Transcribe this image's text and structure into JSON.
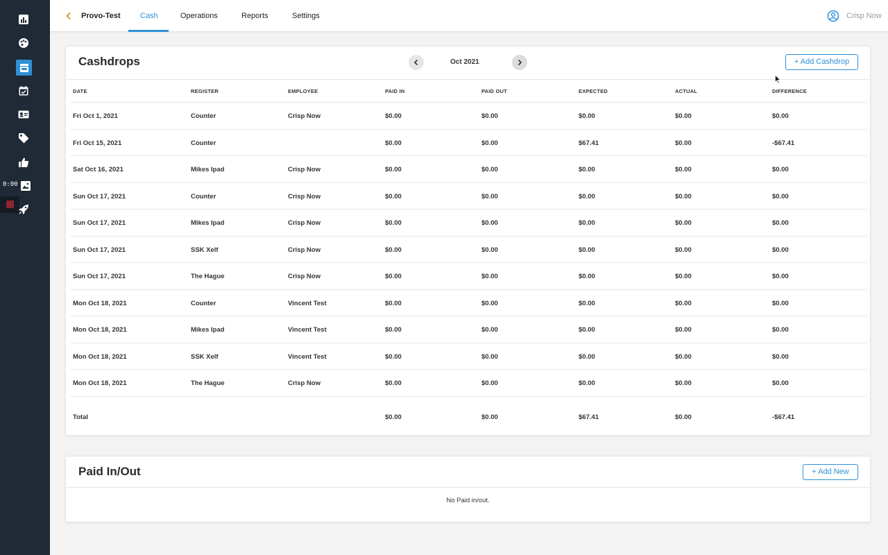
{
  "sidebar": {
    "icons": [
      "bar-chart-icon",
      "palette-icon",
      "store-icon",
      "calendar-check-icon",
      "contact-card-icon",
      "tag-icon",
      "thumbs-up-icon",
      "image-icon",
      "rocket-icon"
    ],
    "recording_time": "0:00"
  },
  "topbar": {
    "location": "Provo-Test",
    "tabs": [
      {
        "label": "Cash",
        "active": true
      },
      {
        "label": "Operations",
        "active": false
      },
      {
        "label": "Reports",
        "active": false
      },
      {
        "label": "Settings",
        "active": false
      }
    ],
    "user_name": "Crisp Now"
  },
  "cashdrops": {
    "title": "Cashdrops",
    "month": "Oct 2021",
    "add_button": "+ Add Cashdrop",
    "columns": [
      "DATE",
      "REGISTER",
      "EMPLOYEE",
      "PAID IN",
      "PAID OUT",
      "EXPECTED",
      "ACTUAL",
      "DIFFERENCE"
    ],
    "rows": [
      [
        "Fri Oct 1, 2021",
        "Counter",
        "Crisp Now",
        "$0.00",
        "$0.00",
        "$0.00",
        "$0.00",
        "$0.00"
      ],
      [
        "Fri Oct 15, 2021",
        "Counter",
        "",
        "$0.00",
        "$0.00",
        "$67.41",
        "$0.00",
        "-$67.41"
      ],
      [
        "Sat Oct 16, 2021",
        "Mikes Ipad",
        "Crisp Now",
        "$0.00",
        "$0.00",
        "$0.00",
        "$0.00",
        "$0.00"
      ],
      [
        "Sun Oct 17, 2021",
        "Counter",
        "Crisp Now",
        "$0.00",
        "$0.00",
        "$0.00",
        "$0.00",
        "$0.00"
      ],
      [
        "Sun Oct 17, 2021",
        "Mikes Ipad",
        "Crisp Now",
        "$0.00",
        "$0.00",
        "$0.00",
        "$0.00",
        "$0.00"
      ],
      [
        "Sun Oct 17, 2021",
        "SSK Xelf",
        "Crisp Now",
        "$0.00",
        "$0.00",
        "$0.00",
        "$0.00",
        "$0.00"
      ],
      [
        "Sun Oct 17, 2021",
        "The Hague",
        "Crisp Now",
        "$0.00",
        "$0.00",
        "$0.00",
        "$0.00",
        "$0.00"
      ],
      [
        "Mon Oct 18, 2021",
        "Counter",
        "Vincent Test",
        "$0.00",
        "$0.00",
        "$0.00",
        "$0.00",
        "$0.00"
      ],
      [
        "Mon Oct 18, 2021",
        "Mikes Ipad",
        "Vincent Test",
        "$0.00",
        "$0.00",
        "$0.00",
        "$0.00",
        "$0.00"
      ],
      [
        "Mon Oct 18, 2021",
        "SSK Xelf",
        "Vincent Test",
        "$0.00",
        "$0.00",
        "$0.00",
        "$0.00",
        "$0.00"
      ],
      [
        "Mon Oct 18, 2021",
        "The Hague",
        "Crisp Now",
        "$0.00",
        "$0.00",
        "$0.00",
        "$0.00",
        "$0.00"
      ]
    ],
    "total": [
      "Total",
      "",
      "",
      "$0.00",
      "$0.00",
      "$67.41",
      "$0.00",
      "-$67.41"
    ]
  },
  "paid_in_out": {
    "title": "Paid In/Out",
    "add_button": "+ Add New",
    "empty_message": "No Paid in/out."
  },
  "colors": {
    "sidebar_bg": "#1f2a36",
    "accent": "#2f8fd6",
    "back_chevron": "#e08a1e"
  }
}
